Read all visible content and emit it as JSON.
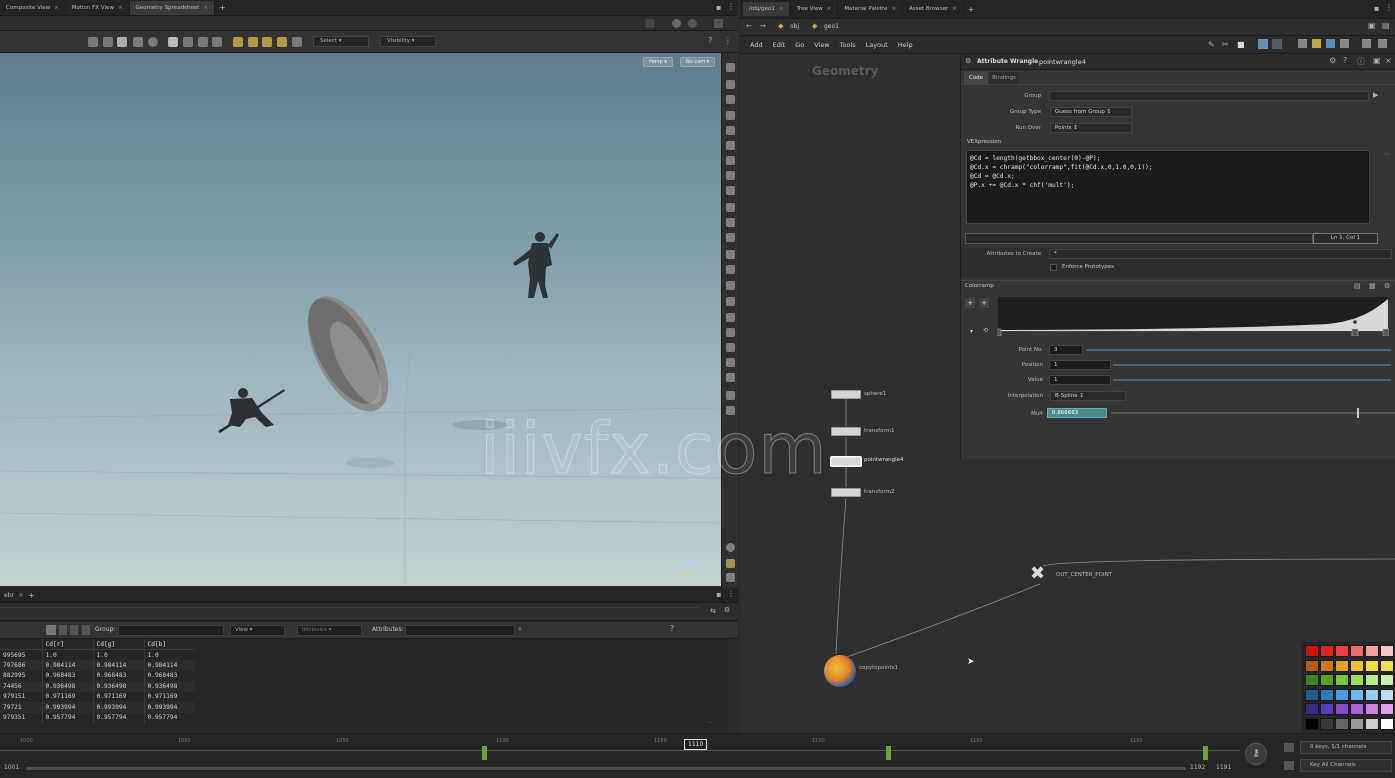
{
  "left_tabs": [
    "Composite View",
    "Motion FX View",
    "Geometry Spreadsheet"
  ],
  "viewport": {
    "chip_persp": "Persp",
    "chip_cam": "No cam",
    "toolbar_select": "Select",
    "toolbar_visibility": "Visibility",
    "frame_readout": "1100"
  },
  "spreadsheet": {
    "group_label": "Group:",
    "view_label": "View",
    "intrinsics_label": "Intrinsics",
    "attributes_label": "Attributes:",
    "headers": [
      "",
      "Cd[r]",
      "Cd[g]",
      "Cd[b]"
    ],
    "rows": [
      [
        "995695",
        "1.0",
        "1.0",
        "1.0"
      ],
      [
        "797686",
        "0.984114",
        "0.984114",
        "0.984114"
      ],
      [
        "882995",
        "0.968483",
        "0.968483",
        "0.968483"
      ],
      [
        "74456",
        "0.936498",
        "0.936498",
        "0.936498"
      ],
      [
        "979151",
        "0.971169",
        "0.971169",
        "0.971169"
      ],
      [
        "79721",
        "0.993994",
        "0.993994",
        "0.993994"
      ],
      [
        "979351",
        "0.957794",
        "0.957794",
        "0.957794"
      ]
    ]
  },
  "timeline": {
    "ticks": [
      "1000",
      "1050",
      "1050",
      "1100",
      "1150",
      "1100",
      "1150",
      "1150"
    ],
    "current_frame": "1110",
    "start_frame": "1001",
    "end_frame_a": "1192",
    "end_frame_b": "1191",
    "keys_label": "0 keys, 1/1 channels",
    "key_all_label": "Key All Channels"
  },
  "right_tabs": [
    "/obj/geo1",
    "Tree View",
    "Material Palette",
    "Asset Browser"
  ],
  "right_path": {
    "obj": "obj",
    "geo": "geo1"
  },
  "right_menu": [
    "Add",
    "Edit",
    "Go",
    "View",
    "Tools",
    "Layout",
    "Help"
  ],
  "network": {
    "context_label": "Geometry",
    "nodes": [
      "sphere1",
      "transform1",
      "pointwrangle4",
      "transform2",
      "OUT_CENTER_POINT",
      "copytopoints1"
    ],
    "watermark": "iiivfx.com"
  },
  "params": {
    "node_type": "Attribute Wrangle",
    "node_name": "pointwrangle4",
    "tabs": [
      "Code",
      "Bindings"
    ],
    "group_label": "Group",
    "group_type_label": "Group Type",
    "group_type_value": "Guess from Group",
    "run_over_label": "Run Over",
    "run_over_value": "Points",
    "vex_label": "VEXpression",
    "vex_lines": [
      "@Cd = length(getbbox_center(0)-@P);",
      "@Cd.x = chramp(\"colorramp\",fit(@Cd.x,0,1.0,0,1));",
      "@Cd = @Cd.x;",
      "",
      "@P.x += @Cd.x * chf('mult');"
    ],
    "cursor_pos": "Ln 1, Col 1",
    "attributes_to_create_label": "Attributes to Create",
    "attributes_to_create_value": "*",
    "enforce_prototypes": "Enforce Prototypes",
    "colorramp_label": "Colorramp",
    "point_no_label": "Point No.",
    "point_no_value": "3",
    "position_label": "Position",
    "position_value": "1",
    "value_label": "Value",
    "value_value": "1",
    "interpolation_label": "Interpolation",
    "interpolation_value": "B-Spline",
    "mult_label": "Mult",
    "mult_value": "0.866663",
    "mult_fraction": 0.87
  }
}
